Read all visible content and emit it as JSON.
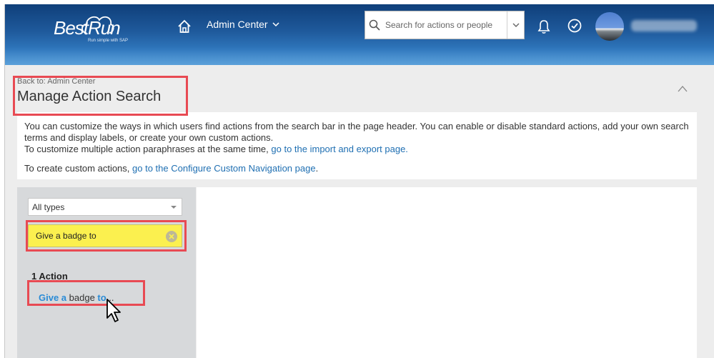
{
  "header": {
    "logo_text": "BestRun",
    "logo_tagline": "Run simple with SAP",
    "admin_menu_label": "Admin Center",
    "search_placeholder": "Search for actions or people"
  },
  "page": {
    "back_link": "Back to: Admin Center",
    "title": "Manage Action Search",
    "description": {
      "line1": "You can customize the ways in which users find actions from the search bar in the page header. You can enable or disable standard actions, add your own search terms and display labels, or create your own custom actions.",
      "line2_prefix": "To customize multiple action paraphrases at the same time, ",
      "line2_link": "go to the import and export page.",
      "line3_prefix": "To create custom actions, ",
      "line3_link": "go to the Configure Custom Navigation page",
      "line3_suffix": "."
    }
  },
  "left_panel": {
    "type_filter_value": "All types",
    "search_value": "Give a badge to",
    "result_count": "1 Action",
    "result": {
      "part1": "Give a",
      "part2": " badge ",
      "part3": "to",
      "part4": "..."
    }
  },
  "colors": {
    "shell_top": "#0f3f7a",
    "shell_bottom": "#4b95d3",
    "link": "#1f6fb2",
    "highlight": "#fbf04f",
    "annotation": "#e84a53"
  }
}
